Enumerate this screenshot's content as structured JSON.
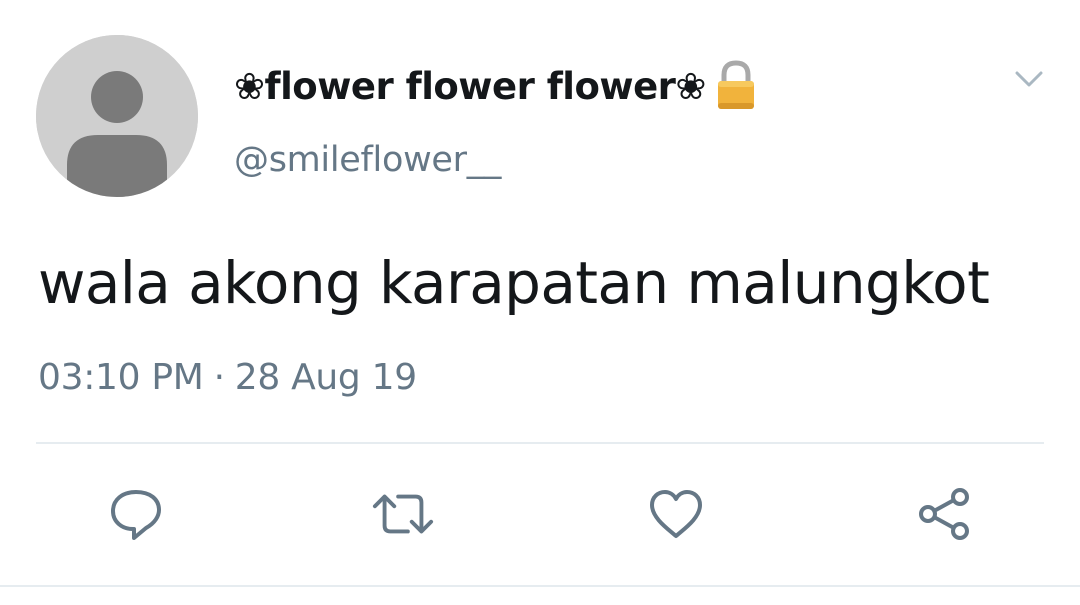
{
  "tweet": {
    "display_name": "❀flower flower flower❀",
    "handle": "@smileflower__",
    "text": "wala akong karapatan malungkot",
    "time": "03:10 PM",
    "separator": "·",
    "date": "28 Aug 19"
  },
  "icons": {
    "avatar": "default-avatar-silhouette",
    "lock": "lock-icon",
    "caret": "chevron-down-icon",
    "reply": "reply-icon",
    "retweet": "retweet-icon",
    "like": "heart-icon",
    "share": "share-icon"
  },
  "colors": {
    "text_primary": "#14171a",
    "text_secondary": "#657786",
    "icon_gray": "#657786",
    "divider": "#e6ecf0",
    "avatar_bg": "#cfcfcf",
    "avatar_fg": "#7a7a7a",
    "lock_gold": "#f1b33c"
  }
}
